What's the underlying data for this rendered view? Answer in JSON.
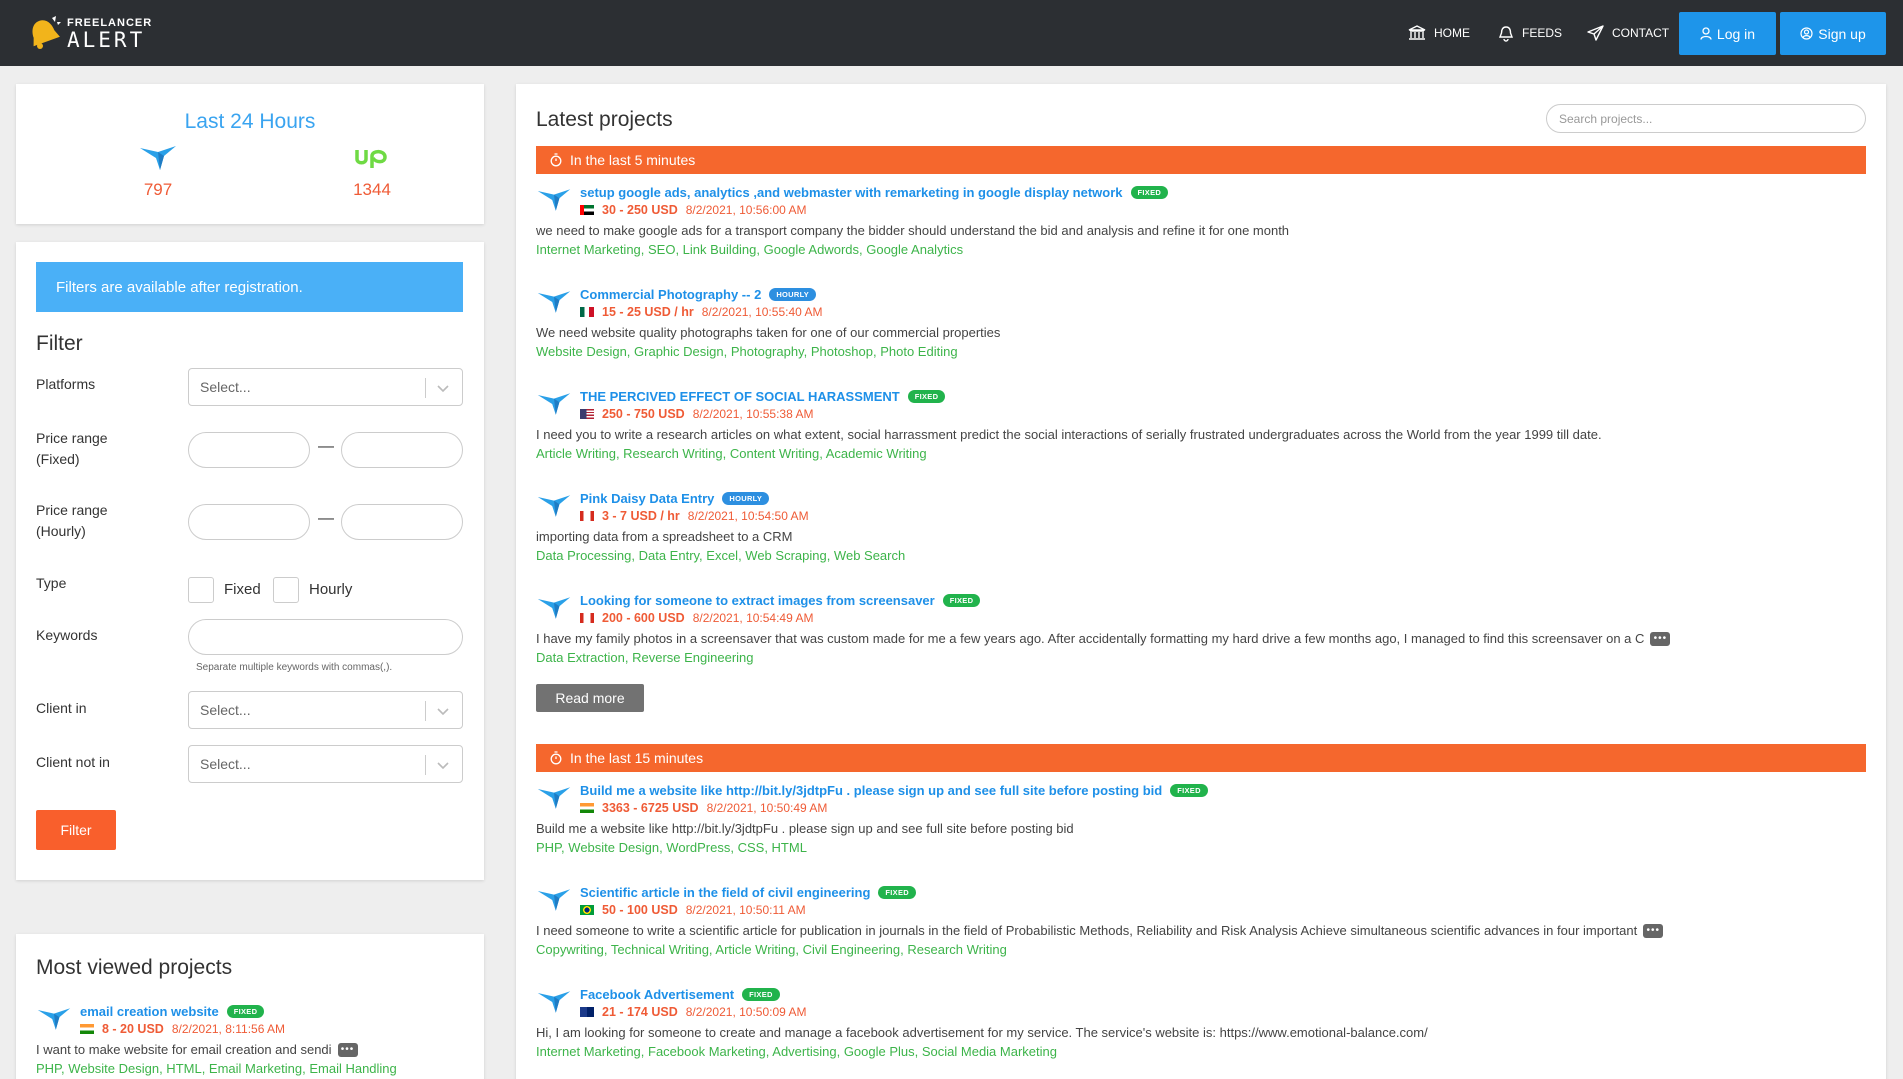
{
  "brand": {
    "top": "FREELANCER",
    "bottom": "ALERT"
  },
  "nav": {
    "home": "HOME",
    "feeds": "FEEDS",
    "contact": "CONTACT",
    "login": "Log in",
    "signup": "Sign up"
  },
  "stats": {
    "title": "Last 24 Hours",
    "items": [
      {
        "platform": "freelancer",
        "count": "797"
      },
      {
        "platform": "upwork",
        "count": "1344"
      }
    ]
  },
  "filter": {
    "notice": "Filters are available after registration.",
    "title": "Filter",
    "platforms_label": "Platforms",
    "platforms_placeholder": "Select...",
    "price_fixed_label_1": "Price range",
    "price_fixed_label_2": "(Fixed)",
    "price_hourly_label_1": "Price range",
    "price_hourly_label_2": "(Hourly)",
    "type_label": "Type",
    "type_fixed": "Fixed",
    "type_hourly": "Hourly",
    "keywords_label": "Keywords",
    "keywords_hint": "Separate multiple keywords with commas(,).",
    "client_in_label": "Client in",
    "client_in_placeholder": "Select...",
    "client_not_in_label": "Client not in",
    "client_not_in_placeholder": "Select...",
    "button": "Filter"
  },
  "main": {
    "title": "Latest projects",
    "search_placeholder": "Search projects...",
    "read_more": "Read more",
    "sections": [
      {
        "label": "In the last 5 minutes",
        "projects": [
          {
            "title": "setup google ads, analytics ,and webmaster with remarketing in google display network",
            "badge": "FIXED",
            "price": "30 - 250 USD",
            "time": "8/2/2021, 10:56:00 AM",
            "flag": "ae",
            "desc": "we need to make google ads for a transport company the bidder should understand the bid and analysis and refine it for one month",
            "tags": "Internet Marketing, SEO, Link Building, Google Adwords, Google Analytics"
          },
          {
            "title": "Commercial Photography -- 2",
            "badge": "HOURLY",
            "price": "15 - 25 USD / hr",
            "time": "8/2/2021, 10:55:40 AM",
            "flag": "mx",
            "desc": "We need website quality photographs taken for one of our commercial properties",
            "tags": "Website Design, Graphic Design, Photography, Photoshop, Photo Editing"
          },
          {
            "title": "THE PERCIVED EFFECT OF SOCIAL HARASSMENT",
            "badge": "FIXED",
            "price": "250 - 750 USD",
            "time": "8/2/2021, 10:55:38 AM",
            "flag": "us",
            "desc": "I need you to write a research articles on what extent, social harrassment predict the social interactions of serially frustrated undergraduates across the World from the year 1999 till date.",
            "tags": "Article Writing, Research Writing, Content Writing, Academic Writing"
          },
          {
            "title": "Pink Daisy Data Entry",
            "badge": "HOURLY",
            "price": "3 - 7 USD / hr",
            "time": "8/2/2021, 10:54:50 AM",
            "flag": "ca",
            "desc": "importing data from a spreadsheet to a CRM",
            "tags": "Data Processing, Data Entry, Excel, Web Scraping, Web Search"
          },
          {
            "title": "Looking for someone to extract images from screensaver",
            "badge": "FIXED",
            "price": "200 - 600 USD",
            "time": "8/2/2021, 10:54:49 AM",
            "flag": "ca",
            "desc": "I have my family photos in a screensaver that was custom made for me a few years ago. After accidentally formatting my hard drive a few months ago, I managed to find this screensaver on a C",
            "tags": "Data Extraction, Reverse Engineering",
            "more": true
          }
        ]
      },
      {
        "label": "In the last 15 minutes",
        "projects": [
          {
            "title": "Build me a website like http://bit.ly/3jdtpFu . please sign up and see full site before posting bid",
            "badge": "FIXED",
            "price": "3363 - 6725 USD",
            "time": "8/2/2021, 10:50:49 AM",
            "flag": "in",
            "desc": "Build me a website like http://bit.ly/3jdtpFu . please sign up and see full site before posting bid",
            "tags": "PHP, Website Design, WordPress, CSS, HTML"
          },
          {
            "title": "Scientific article in the field of civil engineering",
            "badge": "FIXED",
            "price": "50 - 100 USD",
            "time": "8/2/2021, 10:50:11 AM",
            "flag": "br",
            "desc": "I need someone to write a scientific article for publication in journals in the field of Probabilistic Methods, Reliability and Risk Analysis Achieve simultaneous scientific advances in four important",
            "tags": "Copywriting, Technical Writing, Article Writing, Civil Engineering, Research Writing",
            "more": true
          },
          {
            "title": "Facebook Advertisement",
            "badge": "FIXED",
            "price": "21 - 174 USD",
            "time": "8/2/2021, 10:50:09 AM",
            "flag": "au",
            "desc": "Hi, I am looking for someone to create and manage a facebook advertisement for my service. The service's website is: https://www.emotional-balance.com/",
            "tags": "Internet Marketing, Facebook Marketing, Advertising, Google Plus, Social Media Marketing"
          }
        ]
      }
    ]
  },
  "most_viewed": {
    "title": "Most viewed projects",
    "project": {
      "title": "email creation website",
      "badge": "FIXED",
      "price": "8 - 20 USD",
      "time": "8/2/2021, 8:11:56 AM",
      "flag": "in",
      "desc": "I want to make website for email creation and sendi",
      "tags": "PHP, Website Design, HTML, Email Marketing, Email Handling"
    }
  },
  "colors": {
    "accent_blue": "#1e95ea",
    "accent_orange": "#f5672d",
    "tag_green": "#3db44a",
    "price_red": "#ef5b36"
  }
}
